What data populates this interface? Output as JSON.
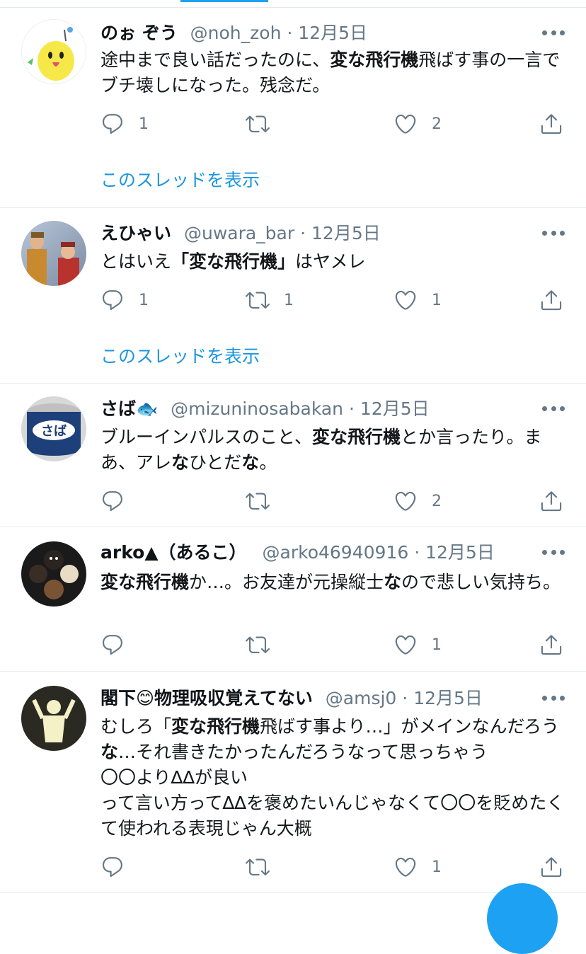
{
  "tweets": [
    {
      "display_name": "のぉ ぞう",
      "handle": "@noh_zoh",
      "date": "12月5日",
      "segments": [
        {
          "t": "途中まで良い話だったのに、",
          "b": false
        },
        {
          "t": "変な飛行機",
          "b": true
        },
        {
          "t": "飛ばす事の一言でブチ壊しになった。残念だ。",
          "b": false
        }
      ],
      "reply_count": "1",
      "retweet_count": "",
      "like_count": "2",
      "thread_link": "このスレッドを表示",
      "avatar_icon": "yellow-chick-avatar"
    },
    {
      "display_name": "えひゃい",
      "handle": "@uwara_bar",
      "date": "12月5日",
      "segments": [
        {
          "t": "とはいえ",
          "b": false
        },
        {
          "t": "「変な飛行機」",
          "b": true
        },
        {
          "t": "はヤメレ",
          "b": false
        }
      ],
      "reply_count": "1",
      "retweet_count": "1",
      "like_count": "1",
      "thread_link": "このスレッドを表示",
      "avatar_icon": "two-people-photo-avatar"
    },
    {
      "display_name": "さば🐟",
      "handle": "@mizuninosabakan",
      "date": "12月5日",
      "segments": [
        {
          "t": "ブルーインパルスのこと、",
          "b": false
        },
        {
          "t": "変な飛行機",
          "b": true
        },
        {
          "t": "とか言ったり。まあ、アレ",
          "b": false
        },
        {
          "t": "な",
          "b": true
        },
        {
          "t": "ひとだ",
          "b": false
        },
        {
          "t": "な",
          "b": true
        },
        {
          "t": "。",
          "b": false
        }
      ],
      "reply_count": "",
      "retweet_count": "",
      "like_count": "2",
      "thread_link": "",
      "avatar_icon": "saba-can-avatar",
      "avatar_label": "さば"
    },
    {
      "display_name": "arko▲（あるこ）",
      "handle": "@arko46940916",
      "date": "12月5日",
      "segments": [
        {
          "t": "変な飛行機",
          "b": true
        },
        {
          "t": "か…。お友達が元操縦士",
          "b": false
        },
        {
          "t": "な",
          "b": true
        },
        {
          "t": "ので悲しい気持ち。",
          "b": false
        }
      ],
      "reply_count": "",
      "retweet_count": "",
      "like_count": "1",
      "thread_link": "",
      "avatar_icon": "plush-toys-avatar"
    },
    {
      "display_name": "閣下😊物理吸収覚えてない",
      "handle": "@amsj0",
      "date": "12月5日",
      "segments": [
        {
          "t": "むしろ「",
          "b": false
        },
        {
          "t": "変な飛行機",
          "b": true
        },
        {
          "t": "飛ばす事より…」がメインなんだろう",
          "b": false
        },
        {
          "t": "な",
          "b": true
        },
        {
          "t": "…それ書きたかったんだろうなって思っちゃう\n〇〇より∆∆が良い\nって言い方って∆∆を褒めたいんじゃなくて〇〇を貶めたくて使われる表現じゃん大概",
          "b": false
        }
      ],
      "reply_count": "",
      "retweet_count": "",
      "like_count": "1",
      "thread_link": "",
      "avatar_icon": "glowing-figure-avatar"
    }
  ],
  "icons": {
    "reply": "reply-icon",
    "retweet": "retweet-icon",
    "like": "heart-icon",
    "share": "share-icon",
    "more": "more-icon"
  },
  "colors": {
    "accent": "#1da1f2",
    "link": "#1b95e0",
    "meta": "#657786",
    "divider": "#e6ecf0"
  }
}
